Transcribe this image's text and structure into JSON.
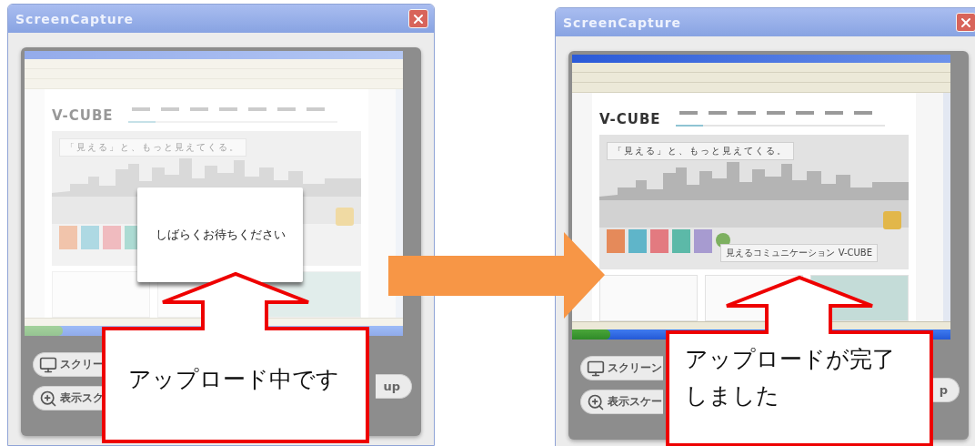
{
  "windows": [
    {
      "title": "ScreenCapture",
      "dimmed": true,
      "screenshot": {
        "logo": "V-CUBE",
        "tagline": "「見える」と、もっと見えてくる。",
        "dialog": "しばらくお待ちください"
      },
      "buttons": [
        "スクリー",
        "表示スク"
      ],
      "side_button": "up",
      "callout": [
        "アップロード中です"
      ]
    },
    {
      "title": "ScreenCapture",
      "dimmed": false,
      "screenshot": {
        "logo": "V-CUBE",
        "tagline": "「見える」と、もっと見えてくる。",
        "caption": "見えるコミュニケーション V-CUBE"
      },
      "buttons": [
        "スクリーン",
        "表示スケー"
      ],
      "side_button": "p",
      "callout": [
        "アップロードが完了",
        "しました"
      ]
    }
  ]
}
